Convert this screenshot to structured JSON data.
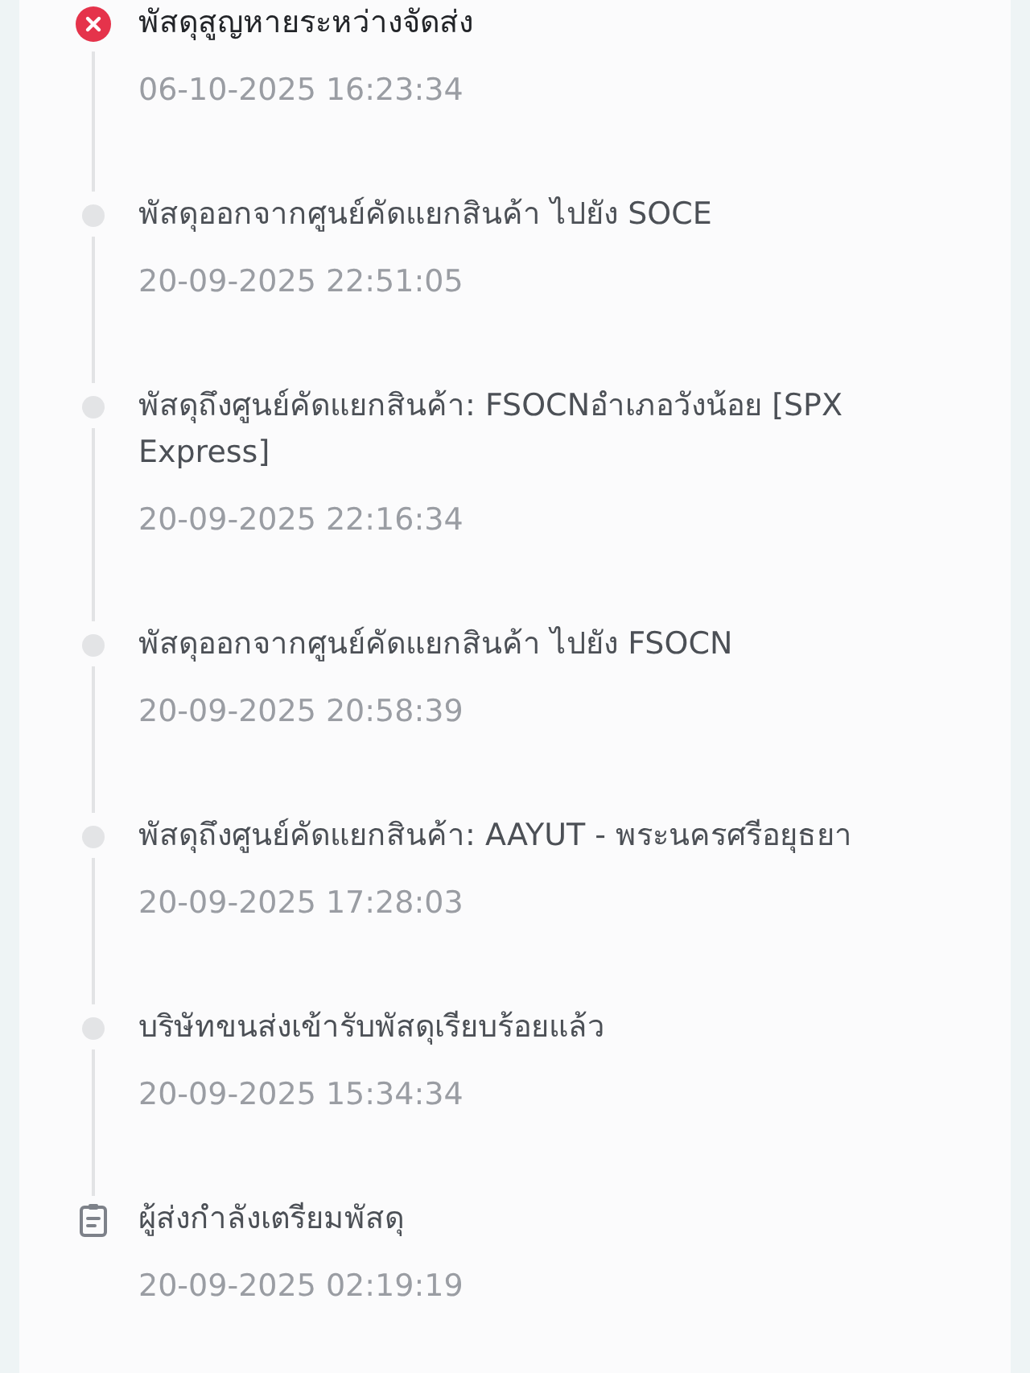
{
  "events": [
    {
      "kind": "failed",
      "title": "พัสดุสูญหายระหว่างจัดส่ง",
      "time": "06-10-2025 16:23:34"
    },
    {
      "kind": "step",
      "title": "พัสดุออกจากศูนย์คัดแยกสินค้า ไปยัง SOCE",
      "time": "20-09-2025 22:51:05"
    },
    {
      "kind": "step",
      "title": "พัสดุถึงศูนย์คัดแยกสินค้า: FSOCNอำเภอวังน้อย [SPX Express]",
      "time": "20-09-2025 22:16:34"
    },
    {
      "kind": "step",
      "title": "พัสดุออกจากศูนย์คัดแยกสินค้า ไปยัง FSOCN",
      "time": "20-09-2025 20:58:39"
    },
    {
      "kind": "step",
      "title": "พัสดุถึงศูนย์คัดแยกสินค้า: AAYUT - พระนครศรีอยุธยา",
      "time": "20-09-2025 17:28:03"
    },
    {
      "kind": "step",
      "title": "บริษัทขนส่งเข้ารับพัสดุเรียบร้อยแล้ว",
      "time": "20-09-2025 15:34:34"
    },
    {
      "kind": "prepared",
      "title": "ผู้ส่งกำลังเตรียมพัสดุ",
      "time": "20-09-2025 02:19:19"
    }
  ]
}
